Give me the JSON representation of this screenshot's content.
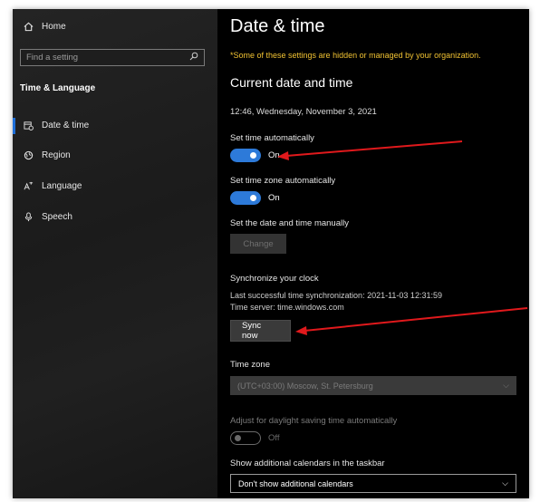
{
  "sidebar": {
    "home_label": "Home",
    "search_placeholder": "Find a setting",
    "section_title": "Time & Language",
    "items": [
      {
        "label": "Date & time",
        "icon": "date-time-icon"
      },
      {
        "label": "Region",
        "icon": "globe-icon"
      },
      {
        "label": "Language",
        "icon": "language-icon"
      },
      {
        "label": "Speech",
        "icon": "microphone-icon"
      }
    ]
  },
  "main": {
    "title": "Date & time",
    "notice": "*Some of these settings are hidden or managed by your organization.",
    "current_heading": "Current date and time",
    "current_datetime": "12:46, Wednesday, November 3, 2021",
    "set_time_auto": {
      "label": "Set time automatically",
      "state": "On"
    },
    "set_timezone_auto": {
      "label": "Set time zone automatically",
      "state": "On"
    },
    "manual": {
      "label": "Set the date and time manually",
      "button": "Change"
    },
    "sync": {
      "heading": "Synchronize your clock",
      "last_sync": "Last successful time synchronization: 2021-11-03 12:31:59",
      "server": "Time server: time.windows.com",
      "button": "Sync now"
    },
    "timezone": {
      "label": "Time zone",
      "value": "(UTC+03:00) Moscow, St. Petersburg"
    },
    "dst": {
      "label": "Adjust for daylight saving time automatically",
      "state": "Off"
    },
    "calendars": {
      "label": "Show additional calendars in the taskbar",
      "value": "Don't show additional calendars"
    }
  },
  "colors": {
    "accent": "#2d7ad9",
    "notice": "#f1c232",
    "annotation_arrow": "#e0191c"
  }
}
